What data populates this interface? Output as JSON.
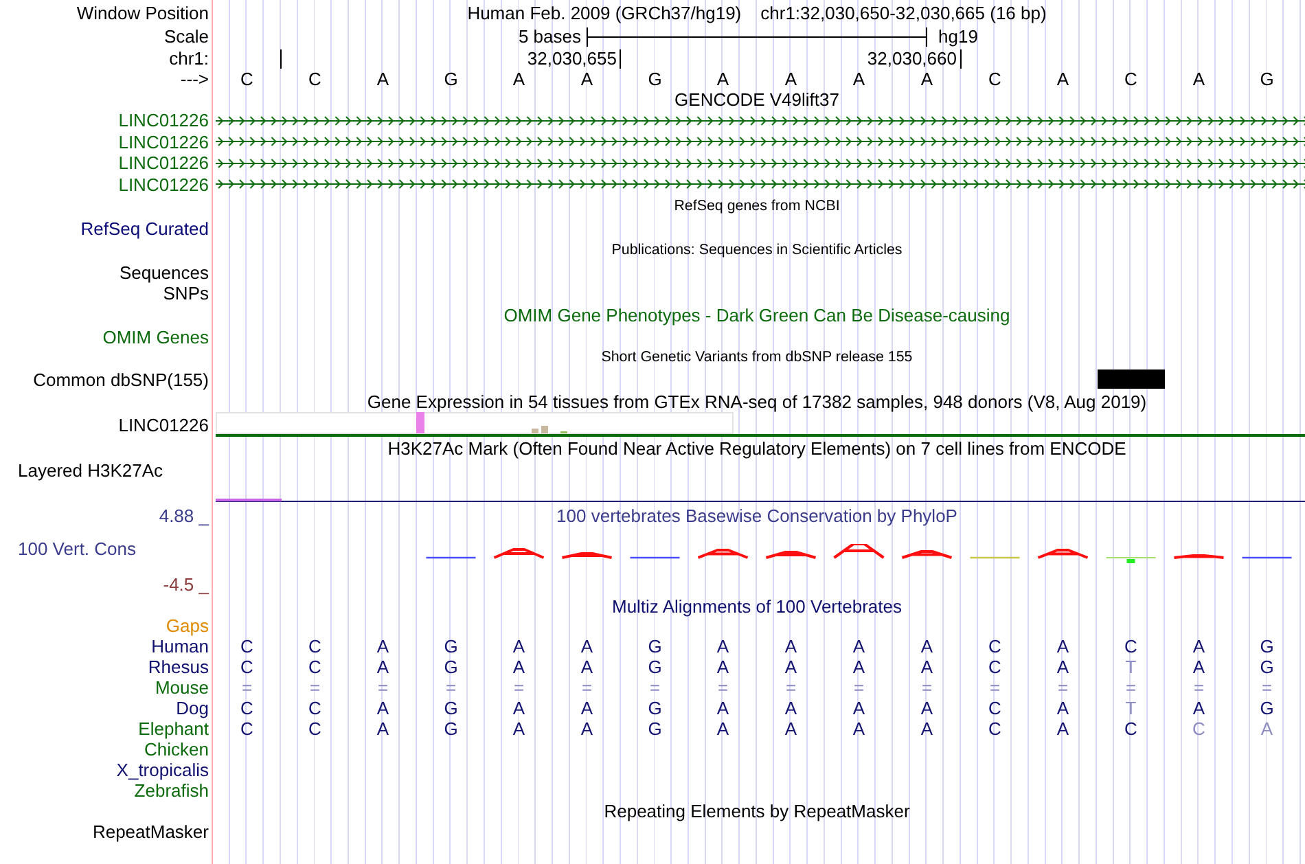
{
  "ruler": {
    "label": "Window Position",
    "assembly": "Human Feb. 2009 (GRCh37/hg19)",
    "position": "chr1:32,030,650-32,030,665 (16 bp)",
    "scale_label": "Scale",
    "scale_text": "5 bases",
    "scale_db": "hg19",
    "chrom_label": "chr1:",
    "tick_labels": [
      "32,030,655",
      "32,030,660"
    ],
    "strand_label": "--->",
    "bases": [
      "C",
      "C",
      "A",
      "G",
      "A",
      "A",
      "G",
      "A",
      "A",
      "A",
      "A",
      "C",
      "A",
      "C",
      "A",
      "G"
    ]
  },
  "tracks": [
    {
      "kind": "genes",
      "title": "GENCODE V49lift37",
      "color": "#000000",
      "rows": [
        {
          "label": "LINC01226",
          "color": "#0c6b0c"
        },
        {
          "label": "LINC01226",
          "color": "#0c6b0c"
        },
        {
          "label": "LINC01226",
          "color": "#0c6b0c"
        },
        {
          "label": "LINC01226",
          "color": "#0c6b0c"
        }
      ]
    },
    {
      "kind": "annotation",
      "title": "RefSeq genes from NCBI",
      "color": "#000000",
      "rows": [
        {
          "label": "RefSeq Curated",
          "color": "#0c0c78"
        }
      ]
    },
    {
      "kind": "annotation",
      "title": "Publications: Sequences in Scientific Articles",
      "color": "#000000",
      "rows": [
        {
          "label": "Sequences",
          "color": "#000000"
        },
        {
          "label": "SNPs",
          "color": "#000000"
        }
      ]
    },
    {
      "kind": "phenotype",
      "title": "OMIM Gene Phenotypes - Dark Green Can Be Disease-causing",
      "color": "#0c6b0c",
      "rows": [
        {
          "label": "OMIM Genes",
          "color": "#0c6b0c"
        }
      ]
    },
    {
      "kind": "variants",
      "title": "Short Genetic Variants from dbSNP release 155",
      "color": "#000000",
      "rows": [
        {
          "label": "Common dbSNP(155)",
          "color": "#000000"
        }
      ]
    },
    {
      "kind": "expression",
      "title": "Gene Expression in 54 tissues from GTEx RNA-seq of 17382 samples, 948 donors (V8, Aug 2019)",
      "color": "#000000",
      "rows": [
        {
          "label": "LINC01226",
          "color": "#000000"
        }
      ]
    },
    {
      "kind": "signal",
      "title": "H3K27Ac Mark (Often Found Near Active Regulatory Elements) on 7 cell lines from ENCODE",
      "color": "#000000",
      "rows": [
        {
          "label": "Layered H3K27Ac",
          "color": "#000000"
        }
      ]
    },
    {
      "kind": "conservation",
      "title": "100 vertebrates Basewise Conservation by PhyloP",
      "color": "#3c3c8c",
      "axis_max": "4.88 _",
      "axis_min": "-4.5 _",
      "rows": [
        {
          "label": "100 Vert. Cons",
          "color": "#3c3c8c"
        }
      ]
    },
    {
      "kind": "alignment",
      "title": "Multiz Alignments of 100 Vertebrates",
      "color": "#101070",
      "rows": [
        {
          "label": "Gaps",
          "color": "#e08a00"
        },
        {
          "label": "Human",
          "color": "#101070",
          "bases": [
            {
              "base": "C",
              "dim": false
            },
            {
              "base": "C",
              "dim": false
            },
            {
              "base": "A",
              "dim": false
            },
            {
              "base": "G",
              "dim": false
            },
            {
              "base": "A",
              "dim": false
            },
            {
              "base": "A",
              "dim": false
            },
            {
              "base": "G",
              "dim": false
            },
            {
              "base": "A",
              "dim": false
            },
            {
              "base": "A",
              "dim": false
            },
            {
              "base": "A",
              "dim": false
            },
            {
              "base": "A",
              "dim": false
            },
            {
              "base": "C",
              "dim": false
            },
            {
              "base": "A",
              "dim": false
            },
            {
              "base": "C",
              "dim": false
            },
            {
              "base": "A",
              "dim": false
            },
            {
              "base": "G",
              "dim": false
            }
          ]
        },
        {
          "label": "Rhesus",
          "color": "#101070",
          "bases": [
            {
              "base": "C",
              "dim": false
            },
            {
              "base": "C",
              "dim": false
            },
            {
              "base": "A",
              "dim": false
            },
            {
              "base": "G",
              "dim": false
            },
            {
              "base": "A",
              "dim": false
            },
            {
              "base": "A",
              "dim": false
            },
            {
              "base": "G",
              "dim": false
            },
            {
              "base": "A",
              "dim": false
            },
            {
              "base": "A",
              "dim": false
            },
            {
              "base": "A",
              "dim": false
            },
            {
              "base": "A",
              "dim": false
            },
            {
              "base": "C",
              "dim": false
            },
            {
              "base": "A",
              "dim": false
            },
            {
              "base": "T",
              "dim": true
            },
            {
              "base": "A",
              "dim": false
            },
            {
              "base": "G",
              "dim": false
            }
          ]
        },
        {
          "label": "Mouse",
          "color": "#0c6b0c",
          "bases": [
            {
              "base": "=",
              "dim": true
            },
            {
              "base": "=",
              "dim": true
            },
            {
              "base": "=",
              "dim": true
            },
            {
              "base": "=",
              "dim": true
            },
            {
              "base": "=",
              "dim": true
            },
            {
              "base": "=",
              "dim": true
            },
            {
              "base": "=",
              "dim": true
            },
            {
              "base": "=",
              "dim": true
            },
            {
              "base": "=",
              "dim": true
            },
            {
              "base": "=",
              "dim": true
            },
            {
              "base": "=",
              "dim": true
            },
            {
              "base": "=",
              "dim": true
            },
            {
              "base": "=",
              "dim": true
            },
            {
              "base": "=",
              "dim": true
            },
            {
              "base": "=",
              "dim": true
            },
            {
              "base": "=",
              "dim": true
            }
          ]
        },
        {
          "label": "Dog",
          "color": "#101070",
          "bases": [
            {
              "base": "C",
              "dim": false
            },
            {
              "base": "C",
              "dim": false
            },
            {
              "base": "A",
              "dim": false
            },
            {
              "base": "G",
              "dim": false
            },
            {
              "base": "A",
              "dim": false
            },
            {
              "base": "A",
              "dim": false
            },
            {
              "base": "G",
              "dim": false
            },
            {
              "base": "A",
              "dim": false
            },
            {
              "base": "A",
              "dim": false
            },
            {
              "base": "A",
              "dim": false
            },
            {
              "base": "A",
              "dim": false
            },
            {
              "base": "C",
              "dim": false
            },
            {
              "base": "A",
              "dim": false
            },
            {
              "base": "T",
              "dim": true
            },
            {
              "base": "A",
              "dim": false
            },
            {
              "base": "G",
              "dim": false
            }
          ]
        },
        {
          "label": "Elephant",
          "color": "#0c6b0c",
          "bases": [
            {
              "base": "C",
              "dim": false
            },
            {
              "base": "C",
              "dim": false
            },
            {
              "base": "A",
              "dim": false
            },
            {
              "base": "G",
              "dim": false
            },
            {
              "base": "A",
              "dim": false
            },
            {
              "base": "A",
              "dim": false
            },
            {
              "base": "G",
              "dim": false
            },
            {
              "base": "A",
              "dim": false
            },
            {
              "base": "A",
              "dim": false
            },
            {
              "base": "A",
              "dim": false
            },
            {
              "base": "A",
              "dim": false
            },
            {
              "base": "C",
              "dim": false
            },
            {
              "base": "A",
              "dim": false
            },
            {
              "base": "C",
              "dim": false
            },
            {
              "base": "C",
              "dim": true
            },
            {
              "base": "A",
              "dim": true
            }
          ]
        },
        {
          "label": "Chicken",
          "color": "#0c6b0c"
        },
        {
          "label": "X_tropicalis",
          "color": "#101070"
        },
        {
          "label": "Zebrafish",
          "color": "#0c6b0c"
        }
      ]
    },
    {
      "kind": "repeats",
      "title": "Repeating Elements by RepeatMasker",
      "color": "#000000",
      "rows": [
        {
          "label": "RepeatMasker",
          "color": "#000000"
        }
      ]
    }
  ]
}
